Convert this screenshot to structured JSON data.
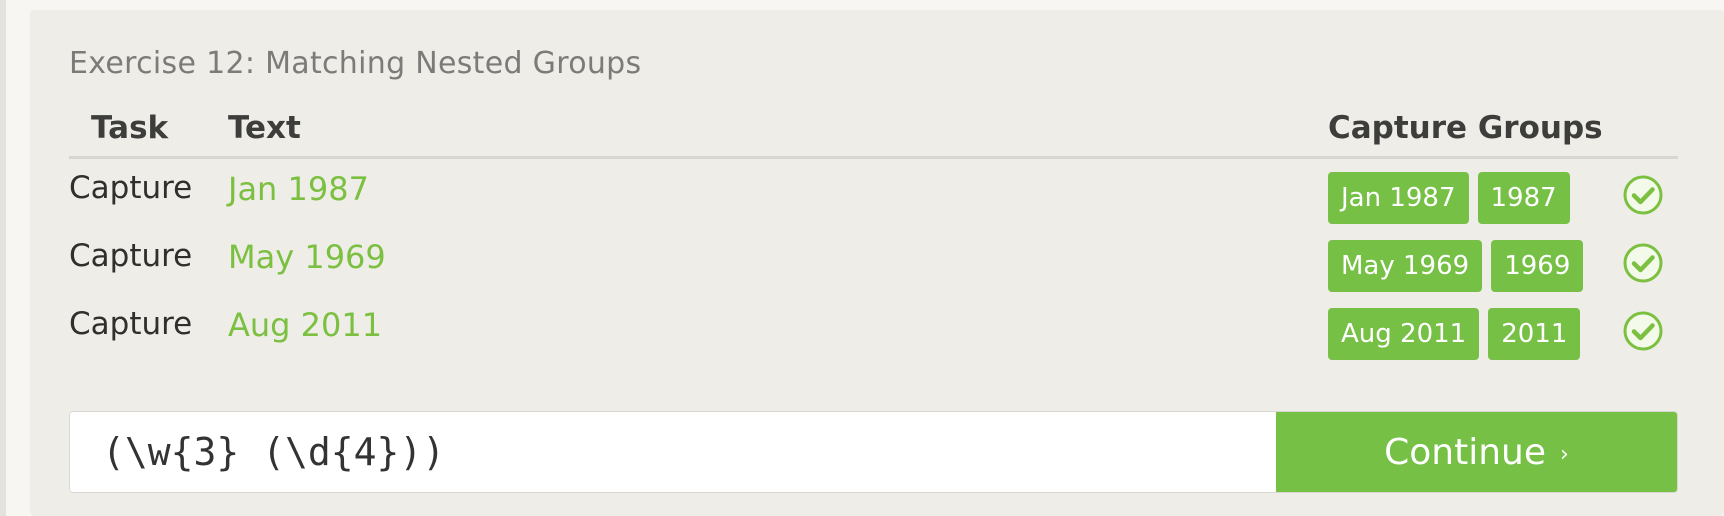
{
  "exercise": {
    "title": "Exercise 12: Matching Nested Groups"
  },
  "table": {
    "headers": {
      "task": "Task",
      "text": "Text",
      "capture_groups": "Capture Groups"
    },
    "rows": [
      {
        "task": "Capture",
        "text": "Jan 1987",
        "groups": [
          "Jan 1987",
          "1987"
        ],
        "status": "matched"
      },
      {
        "task": "Capture",
        "text": "May 1969",
        "groups": [
          "May 1969",
          "1969"
        ],
        "status": "matched"
      },
      {
        "task": "Capture",
        "text": "Aug 2011",
        "groups": [
          "Aug 2011",
          "2011"
        ],
        "status": "matched"
      }
    ]
  },
  "input": {
    "value": "(\\w{3} (\\d{4}))"
  },
  "continue_button": {
    "label": "Continue",
    "chevron": "›"
  },
  "icons": {
    "status": "check-circle-icon",
    "continue": "chevron-right-icon"
  },
  "colors": {
    "accent_green": "#76c045",
    "text_green": "#7cc042",
    "panel_bg": "#efede7"
  }
}
